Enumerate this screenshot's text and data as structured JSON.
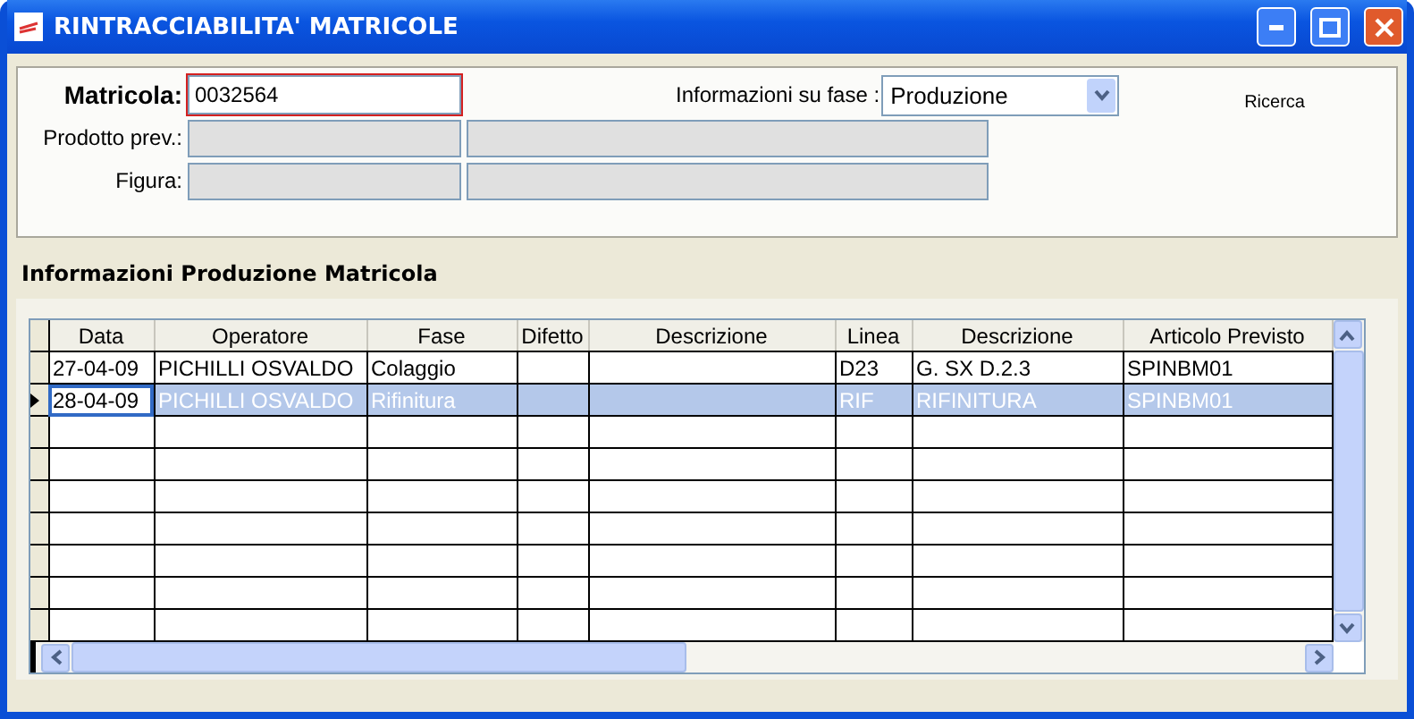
{
  "window": {
    "title": "RINTRACCIABILITA' MATRICOLE"
  },
  "form": {
    "matricola_label": "Matricola:",
    "matricola_value": "0032564",
    "fase_label": "Informazioni su fase :",
    "fase_value": "Produzione",
    "search_link": "Ricerca",
    "prodotto_label": "Prodotto prev.:",
    "figura_label": "Figura:"
  },
  "section_title": "Informazioni Produzione Matricola",
  "table": {
    "columns": [
      "Data",
      "Operatore",
      "Fase",
      "Difetto",
      "Descrizione",
      "Linea",
      "Descrizione",
      "Articolo Previsto"
    ],
    "rows": [
      {
        "selected": false,
        "cells": [
          "27-04-09",
          "PICHILLI OSVALDO",
          "Colaggio",
          "",
          "",
          "D23",
          "G. SX D.2.3",
          "SPINBM01"
        ]
      },
      {
        "selected": true,
        "cells": [
          "28-04-09",
          "PICHILLI OSVALDO",
          "Rifinitura",
          "",
          "",
          "RIF",
          "RIFINITURA",
          "SPINBM01"
        ]
      }
    ]
  }
}
